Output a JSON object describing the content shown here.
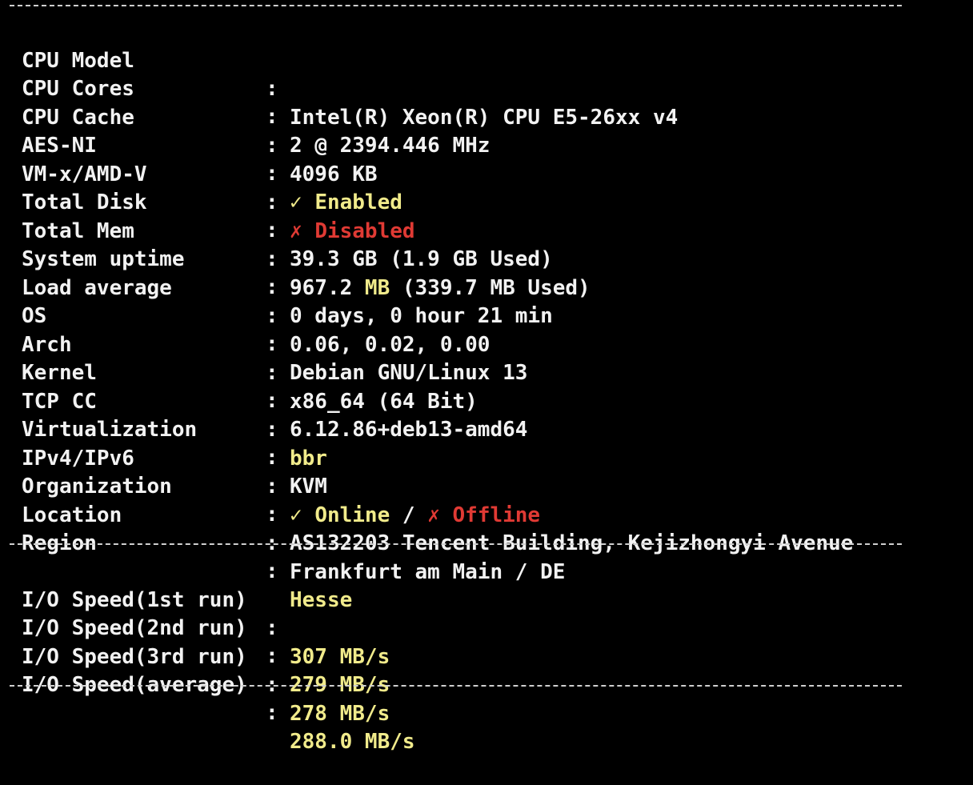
{
  "colors": {
    "background": "#000000",
    "text": "#f2f2f2",
    "yellow": "#f1eb8b",
    "red": "#e03a34"
  },
  "system": [
    {
      "label": "CPU Model",
      "value": "Intel(R) Xeon(R) CPU E5-26xx v4"
    },
    {
      "label": "CPU Cores",
      "value": "2 @ 2394.446 MHz"
    },
    {
      "label": "CPU Cache",
      "value": "4096 KB"
    },
    {
      "label": "AES-NI",
      "mark": "✓",
      "value": "Enabled"
    },
    {
      "label": "VM-x/AMD-V",
      "mark": "✗",
      "value": "Disabled"
    },
    {
      "label": "Total Disk",
      "value": "39.3 GB (1.9 GB Used)"
    },
    {
      "label": "Total Mem",
      "value_a": "967.2 ",
      "value_b": "MB",
      "value_c": " (339.7 MB Used)"
    },
    {
      "label": "System uptime",
      "value": "0 days, 0 hour 21 min"
    },
    {
      "label": "Load average",
      "value": "0.06, 0.02, 0.00"
    },
    {
      "label": "OS",
      "value": "Debian GNU/Linux 13"
    },
    {
      "label": "Arch",
      "value": "x86_64 (64 Bit)"
    },
    {
      "label": "Kernel",
      "value": "6.12.86+deb13-amd64"
    },
    {
      "label": "TCP CC",
      "value": "bbr"
    },
    {
      "label": "Virtualization",
      "value": "KVM"
    },
    {
      "label": "IPv4/IPv6",
      "mark_ok": "✓",
      "value_ok": "Online",
      "sep": " / ",
      "mark_bad": "✗",
      "value_bad": "Offline"
    },
    {
      "label": "Organization",
      "value": "AS132203 Tencent Building, Kejizhongyi Avenue"
    },
    {
      "label": "Location",
      "value": "Frankfurt am Main / DE"
    },
    {
      "label": "Region",
      "value": "Hesse"
    }
  ],
  "io": [
    {
      "label": "I/O Speed(1st run)",
      "value": "307 MB/s"
    },
    {
      "label": "I/O Speed(2nd run)",
      "value": "279 MB/s"
    },
    {
      "label": "I/O Speed(3rd run)",
      "value": "278 MB/s"
    },
    {
      "label": "I/O Speed(average)",
      "value": "288.0 MB/s"
    }
  ],
  "colon": ":"
}
